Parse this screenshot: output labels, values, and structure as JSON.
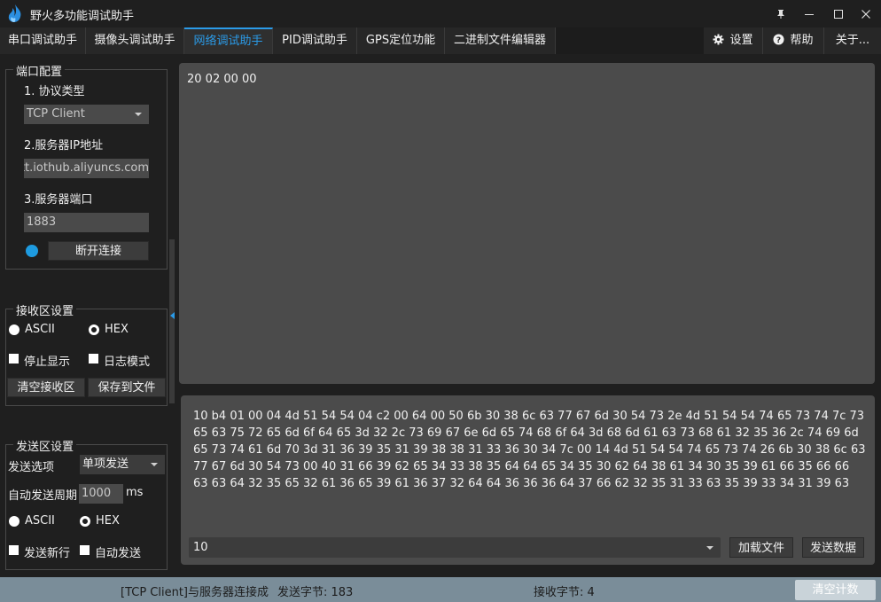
{
  "window": {
    "title": "野火多功能调试助手"
  },
  "tabs": [
    {
      "label": "串口调试助手"
    },
    {
      "label": "摄像头调试助手"
    },
    {
      "label": "网络调试助手"
    },
    {
      "label": "PID调试助手"
    },
    {
      "label": "GPS定位功能"
    },
    {
      "label": "二进制文件编辑器"
    }
  ],
  "active_tab": "网络调试助手",
  "top_right": {
    "settings": "设置",
    "help": "帮助",
    "about": "关于..."
  },
  "port_config": {
    "title": "端口配置",
    "protocol_label": "1. 协议类型",
    "protocol_value": "TCP Client",
    "server_ip_label": "2.服务器IP地址",
    "server_ip_value": "ttt.iothub.aliyuncs.com",
    "server_port_label": "3.服务器端口",
    "server_port_value": "1883",
    "disconnect_button": "断开连接",
    "status_color": "#1e9be0"
  },
  "receive_settings": {
    "title": "接收区设置",
    "ascii_label": "ASCII",
    "hex_label": "HEX",
    "selected_mode": "ASCII",
    "stop_display_label": "停止显示",
    "log_mode_label": "日志模式",
    "clear_button": "清空接收区",
    "save_button": "保存到文件"
  },
  "send_settings": {
    "title": "发送区设置",
    "send_option_label": "发送选项",
    "send_option_value": "单项发送",
    "auto_period_label": "自动发送周期",
    "auto_period_value": "1000",
    "auto_period_unit": "ms",
    "ascii_label": "ASCII",
    "hex_label": "HEX",
    "selected_mode": "ASCII",
    "newline_label": "发送新行",
    "auto_send_label": "自动发送"
  },
  "receive_area": {
    "content": "20 02 00 00"
  },
  "send_area": {
    "content": "10 b4 01 00 04 4d 51 54 54 04 c2 00 64 00 50 6b 30 38 6c 63 77 67 6d 30 54 73 2e 4d 51 54 54 74 65 73 74 7c 73 65 63 75 72 65 6d 6f 64 65 3d 32 2c 73 69 67 6e 6d 65 74 68 6f 64 3d 68 6d 61 63 73 68 61 32 35 36 2c 74 69 6d 65 73 74 61 6d 70 3d 31 36 39 35 31 39 38 38 31 33 36 30 34 7c 00 14 4d 51 54 54 74 65 73 74 26 6b 30 38 6c 63 77 67 6d 30 54 73 00 40 31 66 39 62 65 34 33 38 35 64 64 65 34 35 30 62 64 38 61 34 30 35 39 61 66 35 66 66 63 63 64 32 35 65 32 61 36 65 39 61 36 37 32 64 64 36 36 36 64 37 66 62 32 35 31 33 63 35 39 33 34 31 39 63",
    "combo_value": "10",
    "load_file_button": "加载文件",
    "send_button": "发送数据"
  },
  "status_bar": {
    "connection": "[TCP Client]与服务器连接成",
    "sent_bytes": "发送字节: 183",
    "received_bytes": "接收字节: 4",
    "clear_count_button": "清空计数"
  }
}
